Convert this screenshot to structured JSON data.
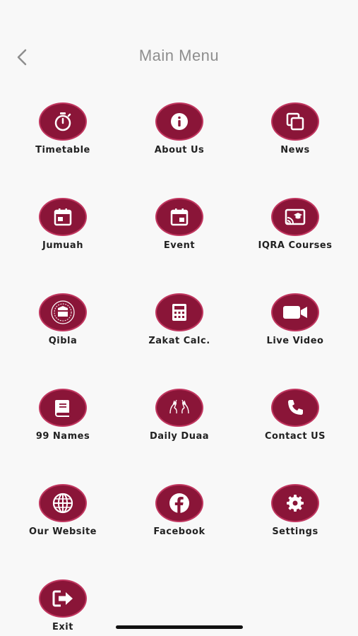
{
  "header": {
    "title": "Main Menu",
    "back_icon": "chevron-left-icon"
  },
  "colors": {
    "accent": "#8a1538",
    "accent_border": "#c0365f",
    "title": "#8e8e8e",
    "background": "#f8f8f8"
  },
  "menu": [
    {
      "label": "Timetable",
      "icon": "timer-icon"
    },
    {
      "label": "About Us",
      "icon": "info-icon"
    },
    {
      "label": "News",
      "icon": "copy-icon"
    },
    {
      "label": "Jumuah",
      "icon": "calendar-icon"
    },
    {
      "label": "Event",
      "icon": "calendar-event-icon"
    },
    {
      "label": "IQRA Courses",
      "icon": "cast-education-icon"
    },
    {
      "label": "Qibla",
      "icon": "kaaba-icon"
    },
    {
      "label": "Zakat Calc.",
      "icon": "calculator-icon"
    },
    {
      "label": "Live Video",
      "icon": "video-camera-icon"
    },
    {
      "label": "99 Names",
      "icon": "book-icon"
    },
    {
      "label": "Daily Duaa",
      "icon": "praying-hands-icon"
    },
    {
      "label": "Contact US",
      "icon": "phone-icon"
    },
    {
      "label": "Our Website",
      "icon": "globe-icon"
    },
    {
      "label": "Facebook",
      "icon": "facebook-icon"
    },
    {
      "label": "Settings",
      "icon": "gear-icon"
    },
    {
      "label": "Exit",
      "icon": "exit-icon"
    }
  ]
}
